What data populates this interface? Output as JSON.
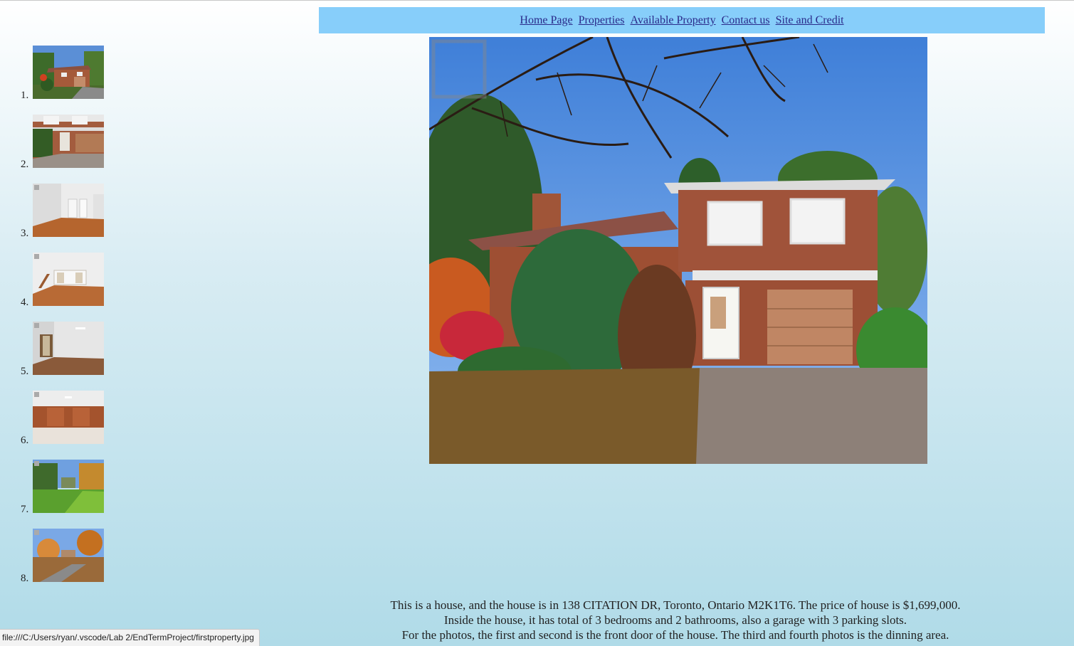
{
  "nav": {
    "links": [
      "Home Page",
      "Properties",
      "Available Property",
      "Contact us",
      "Site and Credit"
    ]
  },
  "gallery": {
    "items": [
      {
        "num": "1.",
        "scene": "house-front"
      },
      {
        "num": "2.",
        "scene": "front-door"
      },
      {
        "num": "3.",
        "scene": "room"
      },
      {
        "num": "4.",
        "scene": "dining"
      },
      {
        "num": "5.",
        "scene": "bedroom"
      },
      {
        "num": "6.",
        "scene": "wood-room"
      },
      {
        "num": "7.",
        "scene": "lawn"
      },
      {
        "num": "8.",
        "scene": "street"
      }
    ]
  },
  "description": {
    "line1": "This is a house, and the house is in 138 CITATION DR, Toronto, Ontario M2K1T6. The price of house is $1,699,000.",
    "line2": "Inside the house, it has total of 3 bedrooms and 2 bathrooms, also a garage with 3 parking slots.",
    "line3": "For the photos, the first and second is the front door of the house. The third and fourth photos is the dinning area."
  },
  "status": {
    "url": "file:///C:/Users/ryan/.vscode/Lab 2/EndTermProject/firstproperty.jpg"
  },
  "colors": {
    "nav_bg": "#87cefa",
    "link": "#2a2a8a"
  }
}
